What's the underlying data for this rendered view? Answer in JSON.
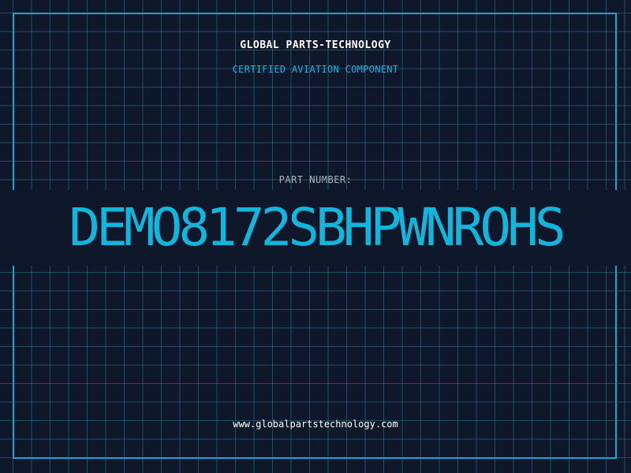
{
  "header": {
    "company_name": "GLOBAL PARTS-TECHNOLOGY",
    "subtitle": "CERTIFIED AVIATION COMPONENT"
  },
  "part": {
    "label": "PART NUMBER:",
    "number": "DEMO8172SBHPWNROHS"
  },
  "footer": {
    "website": "www.globalpartstechnology.com"
  },
  "colors": {
    "background": "#0f172a",
    "grid": "#388caa",
    "frame": "#1aa6d0",
    "accent": "#12b5dc",
    "label": "#a8b4c4",
    "text": "#ffffff"
  }
}
